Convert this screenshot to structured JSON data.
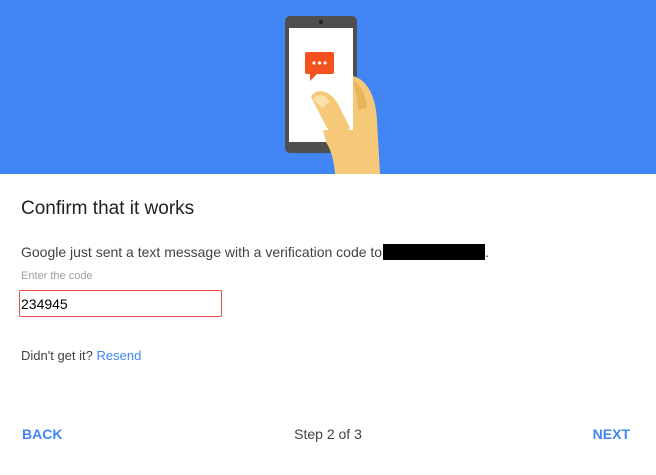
{
  "dialog": {
    "title": "Confirm that it works",
    "message": "Google just sent a text message with a verification code to",
    "message_suffix": ".",
    "field_label": "Enter the code",
    "code_value": "234945",
    "resend_prompt": "Didn't get it?",
    "resend_link": "Resend"
  },
  "footer": {
    "back_label": "BACK",
    "step_text": "Step 2 of 3",
    "next_label": "NEXT"
  },
  "colors": {
    "banner": "#4285f4",
    "accent": "#4285f4",
    "error_border": "#e74c4c",
    "chat_bubble": "#f4511e"
  },
  "icons": {
    "illustration": "phone-with-hand-illustration",
    "message": "chat-bubble-icon"
  }
}
